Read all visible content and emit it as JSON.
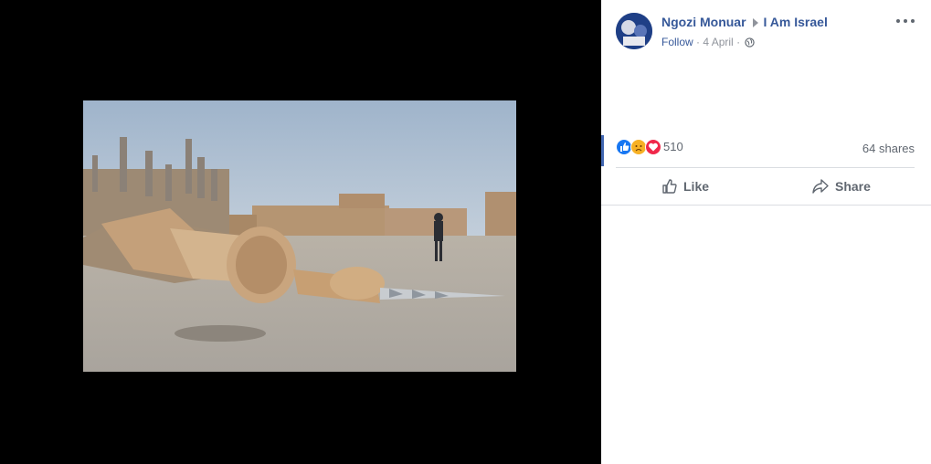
{
  "post": {
    "author": "Ngozi Monuar",
    "group": "I Am Israel",
    "follow_label": "Follow",
    "separator": "·",
    "date": "4 April"
  },
  "reactions": {
    "icons": [
      "like-icon",
      "sad-icon",
      "love-icon"
    ],
    "count": "510"
  },
  "shares": "64 shares",
  "actions": {
    "like_label": "Like",
    "share_label": "Share"
  },
  "colors": {
    "link": "#365899",
    "like": "#1877f2",
    "sad": "#f7b125",
    "love": "#f0284a",
    "panel_background": "#ffffff",
    "viewer_background": "#000000"
  }
}
